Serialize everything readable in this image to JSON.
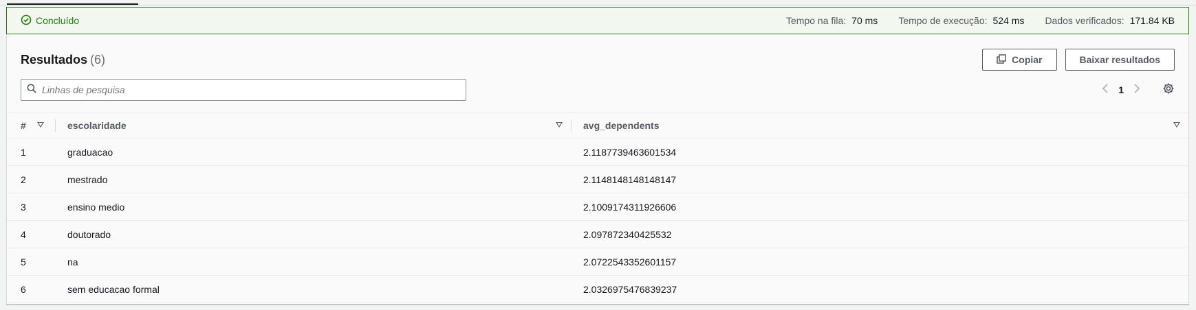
{
  "status": {
    "label": "Concluído",
    "color": "#1d8102",
    "metrics": [
      {
        "label": "Tempo na fila:",
        "value": "70 ms"
      },
      {
        "label": "Tempo de execução:",
        "value": "524 ms"
      },
      {
        "label": "Dados verificados:",
        "value": "171.84 KB"
      }
    ]
  },
  "results": {
    "title": "Resultados",
    "count": "(6)",
    "copy_label": "Copiar",
    "download_label": "Baixar resultados",
    "search_placeholder": "Linhas de pesquisa",
    "page": "1"
  },
  "table": {
    "columns": [
      "#",
      "escolaridade",
      "avg_dependents"
    ],
    "rows": [
      [
        "1",
        "graduacao",
        "2.1187739463601534"
      ],
      [
        "2",
        "mestrado",
        "2.1148148148148147"
      ],
      [
        "3",
        "ensino medio",
        "2.1009174311926606"
      ],
      [
        "4",
        "doutorado",
        "2.097872340425532"
      ],
      [
        "5",
        "na",
        "2.0722543352601157"
      ],
      [
        "6",
        "sem educacao formal",
        "2.0326975476839237"
      ]
    ]
  }
}
